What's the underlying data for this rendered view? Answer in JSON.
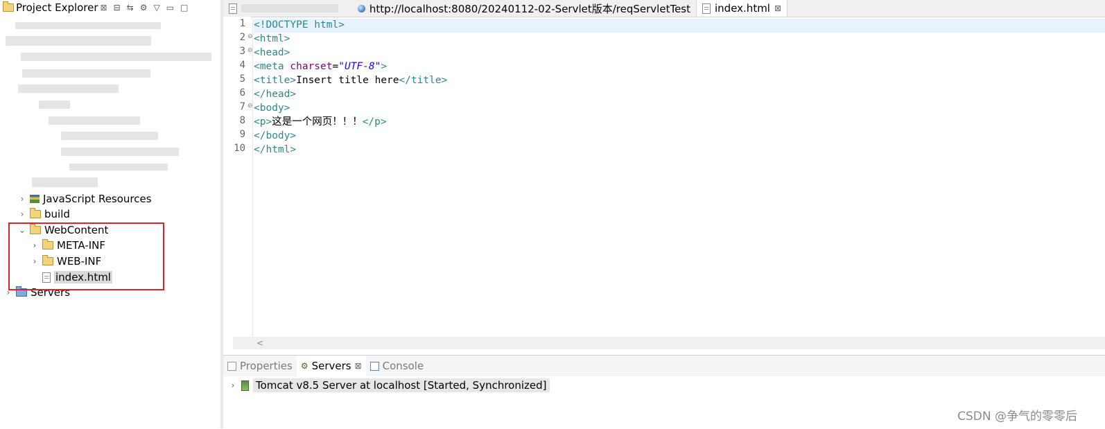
{
  "explorer": {
    "title": "Project Explorer",
    "tree": {
      "javascript_resources": "JavaScript Resources",
      "build": "build",
      "webcontent": "WebContent",
      "meta_inf": "META-INF",
      "web_inf": "WEB-INF",
      "index_html": "index.html",
      "servers": "Servers"
    }
  },
  "editor": {
    "tabs": [
      {
        "label": ""
      },
      {
        "label": "http://localhost:8080/20240112-02-Servlet版本/reqServletTest"
      },
      {
        "label": "index.html"
      }
    ],
    "line_numbers": [
      "1",
      "2",
      "3",
      "4",
      "5",
      "6",
      "7",
      "8",
      "9",
      "10"
    ],
    "code": {
      "l1a": "<!DOCTYPE",
      "l1b": " html>",
      "l2": "<html>",
      "l3": "<head>",
      "l4a": "<meta",
      "l4b": " charset",
      "l4c": "=",
      "l4d": "\"UTF-8\"",
      "l4e": ">",
      "l5a": "<title>",
      "l5b": "Insert title here",
      "l5c": "</title>",
      "l6": "</head>",
      "l7": "<body>",
      "l8a": "<p>",
      "l8b": "这是一个网页！！！",
      "l8c": "</p>",
      "l9": "</body>",
      "l10": "</html>"
    },
    "scroll_left_glyph": "<"
  },
  "bottom_panel": {
    "tabs": [
      "Properties",
      "Servers",
      "Console"
    ],
    "server_entry": "Tomcat v8.5 Server at localhost  [Started, Synchronized]"
  },
  "watermark": "CSDN @争气的零零后"
}
